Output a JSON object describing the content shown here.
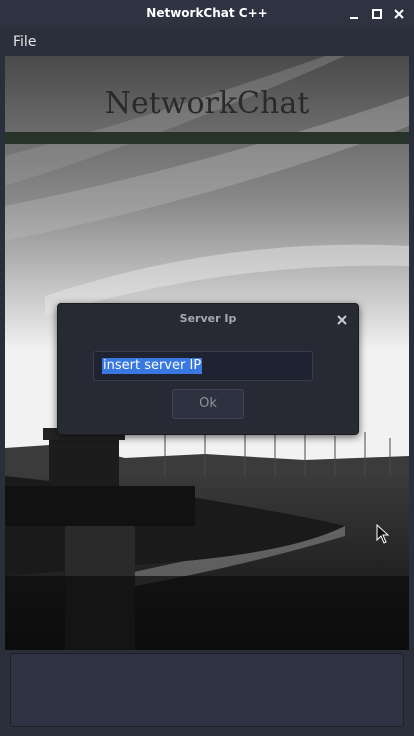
{
  "window": {
    "title": "NetworkChat C++"
  },
  "menu": {
    "file_label": "File"
  },
  "banner": {
    "title": "NetworkChat"
  },
  "dialog": {
    "title": "Server Ip",
    "input_value": "insert server IP",
    "ok_label": "Ok"
  },
  "message_input": {
    "value": ""
  },
  "icons": {
    "minimize": "minimize-icon",
    "maximize": "maximize-icon",
    "close": "close-icon",
    "dialog_close": "close-icon",
    "cursor": "mouse-pointer-icon"
  },
  "colors": {
    "window_bg": "#2b2e3b",
    "dialog_bg": "#272a35",
    "selection": "#3878e0",
    "banner_bar": "#273228"
  }
}
